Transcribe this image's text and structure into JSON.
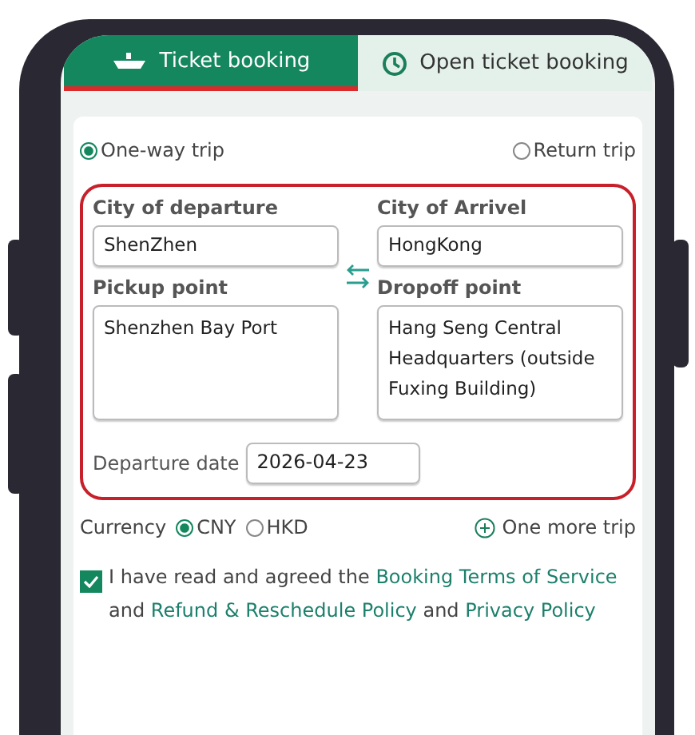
{
  "tabs": [
    {
      "label": "Ticket booking",
      "selected": true,
      "kind": "boat"
    },
    {
      "label": "Open ticket booking",
      "selected": false,
      "kind": "clock"
    }
  ],
  "trip_type": [
    {
      "label": "One-way trip",
      "selected": true
    },
    {
      "label": "Return trip",
      "selected": false
    }
  ],
  "route": {
    "departure": {
      "label": "City of departure",
      "value": "ShenZhen"
    },
    "arrival": {
      "label": "City of Arrivel",
      "value": "HongKong"
    },
    "pickup": {
      "label": "Pickup point",
      "value": "Shenzhen Bay Port"
    },
    "dropoff": {
      "label": "Dropoff point",
      "value": "Hang Seng Central Headquarters (outside Fuxing Building)"
    },
    "date": {
      "label": "Departure date",
      "value": "2026-04-23"
    }
  },
  "currency": {
    "label": "Currency",
    "options": [
      {
        "label": "CNY",
        "selected": true
      },
      {
        "label": "HKD",
        "selected": false
      }
    ]
  },
  "add_trip": "One more trip",
  "agreement": {
    "checked": true,
    "parts": [
      {
        "kind": "text",
        "text": "I have read and agreed the "
      },
      {
        "kind": "link",
        "text": "Booking Terms of Service"
      },
      {
        "kind": "text",
        "text": " and "
      },
      {
        "kind": "link",
        "text": "Refund & Reschedule Policy"
      },
      {
        "kind": "text",
        "text": " and "
      },
      {
        "kind": "link",
        "text": "Privacy Policy"
      }
    ]
  }
}
